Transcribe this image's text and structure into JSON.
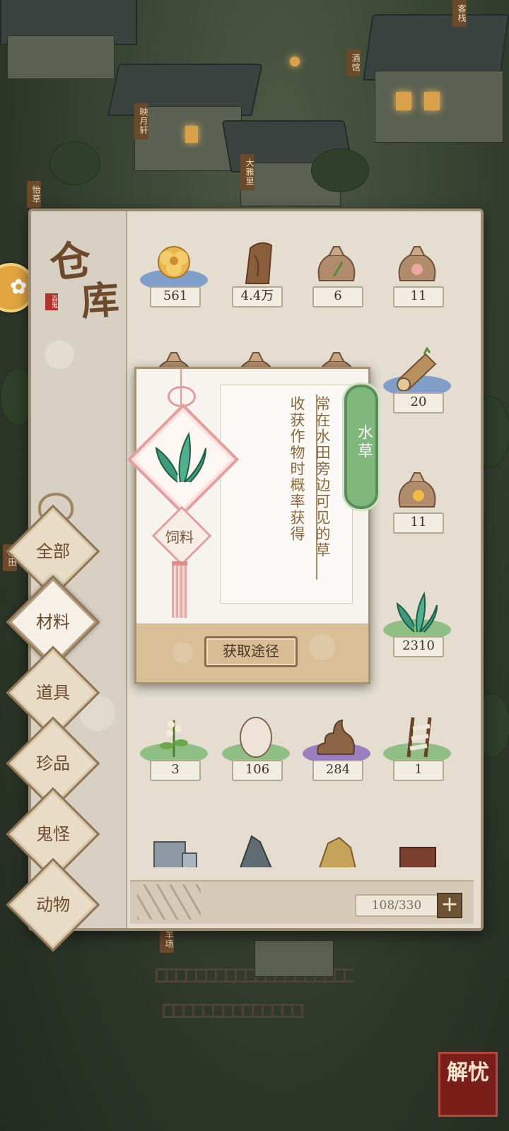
{
  "background": {
    "signs": [
      "客栈",
      "酒馆",
      "映月轩",
      "大雅里",
      "怡草",
      "旱田",
      "羊场"
    ],
    "badge_label": "解忧"
  },
  "warehouse": {
    "title_chars": [
      "仓",
      "库"
    ],
    "seal_text": "百鬼",
    "tabs": [
      {
        "label": "全部",
        "active": false
      },
      {
        "label": "材料",
        "active": true
      },
      {
        "label": "道具",
        "active": false
      },
      {
        "label": "珍品",
        "active": false
      },
      {
        "label": "鬼怪",
        "active": false
      },
      {
        "label": "动物",
        "active": false
      }
    ],
    "items": [
      {
        "icon": "yellow-flower-icon",
        "count": "561",
        "pad": "#7f9fc9"
      },
      {
        "icon": "tree-trunk-icon",
        "count": "4.4万",
        "pad": "none"
      },
      {
        "icon": "herb-seed-bag-icon",
        "count": "6",
        "pad": "none"
      },
      {
        "icon": "peach-seed-bag-icon",
        "count": "11",
        "pad": "none"
      },
      {
        "icon": "seed-bag-icon",
        "count": "",
        "pad": "none"
      },
      {
        "icon": "seed-bag-icon",
        "count": "",
        "pad": "none"
      },
      {
        "icon": "seed-bag-icon",
        "count": "",
        "pad": "none"
      },
      {
        "icon": "wood-log-icon",
        "count": "20",
        "pad": "#7f9fc9"
      },
      {
        "icon": "flower-seed-bag-icon",
        "count": "11",
        "pad": "none"
      },
      {
        "icon": "water-grass-icon",
        "count": "2310",
        "pad": "#8fbf84"
      },
      {
        "icon": "flower-sprig-icon",
        "count": "3",
        "pad": "#8fbf84"
      },
      {
        "icon": "egg-icon",
        "count": "106",
        "pad": "#8fbf84"
      },
      {
        "icon": "manure-icon",
        "count": "284",
        "pad": "#9b7fbd"
      },
      {
        "icon": "wooden-ladder-icon",
        "count": "1",
        "pad": "#8fbf84"
      },
      {
        "icon": "stone-block-icon",
        "count": "",
        "pad": "none"
      },
      {
        "icon": "rock-icon",
        "count": "",
        "pad": "none"
      },
      {
        "icon": "gold-ore-icon",
        "count": "",
        "pad": "none"
      },
      {
        "icon": "brick-icon",
        "count": "",
        "pad": "none"
      }
    ],
    "capacity": "108/330",
    "expand_label": "+"
  },
  "popup": {
    "name": "水草",
    "category": "饲料",
    "description_lines": [
      "常在水田旁边可见的草",
      "收获作物时概率获得"
    ],
    "action_label": "获取途径"
  },
  "colors": {
    "panel_bg": "#e4ddd0",
    "tab_text": "#6b4a2f",
    "name_tag": "#7fb77c",
    "desc_text": "#8b6a3c"
  }
}
